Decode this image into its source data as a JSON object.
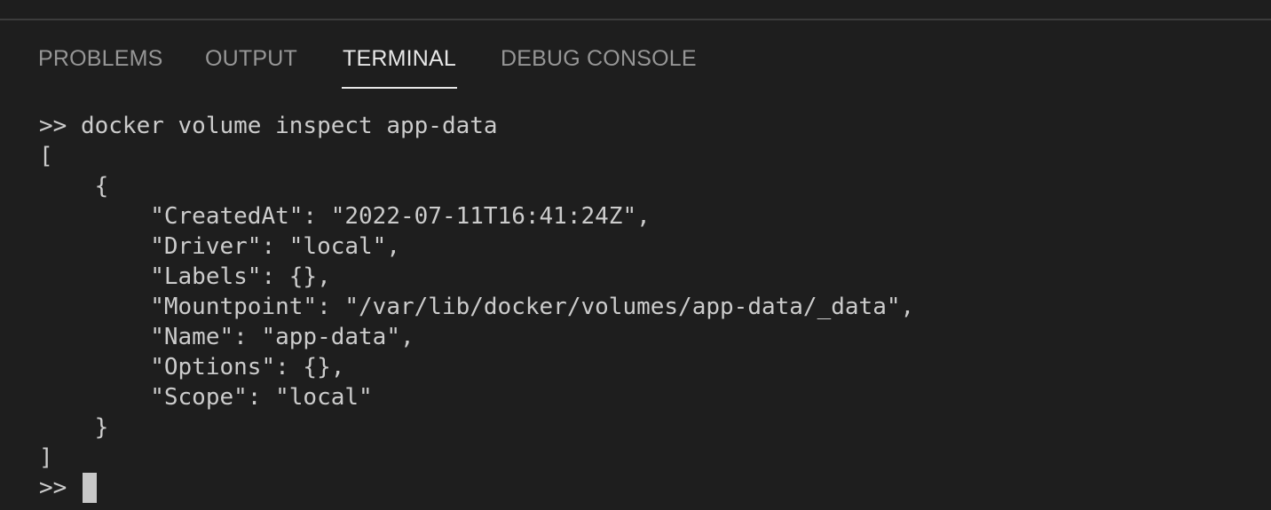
{
  "top_ghost_text": "",
  "panel": {
    "tabs": [
      {
        "label": "PROBLEMS",
        "active": false
      },
      {
        "label": "OUTPUT",
        "active": false
      },
      {
        "label": "TERMINAL",
        "active": true
      },
      {
        "label": "DEBUG CONSOLE",
        "active": false
      }
    ]
  },
  "terminal": {
    "lines": [
      ">> docker volume inspect app-data",
      "[",
      "    {",
      "        \"CreatedAt\": \"2022-07-11T16:41:24Z\",",
      "        \"Driver\": \"local\",",
      "        \"Labels\": {},",
      "        \"Mountpoint\": \"/var/lib/docker/volumes/app-data/_data\",",
      "        \"Name\": \"app-data\",",
      "        \"Options\": {},",
      "        \"Scope\": \"local\"",
      "    }",
      "]"
    ],
    "prompt": ">>"
  },
  "colors": {
    "background": "#1e1e1e",
    "text": "#cccccc",
    "tab_inactive": "#969696",
    "tab_active": "#e7e7e7"
  }
}
